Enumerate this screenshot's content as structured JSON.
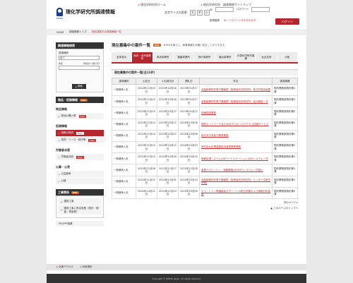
{
  "header": {
    "logo_sub": "RIKEN",
    "site_title": "理化学研究所調達情報",
    "links": [
      "理化学研究所ホーム",
      "文字サイズの変更",
      "理化学研究所　調達情報サイトマップ"
    ],
    "fontsize_label": "文字サイズの変更",
    "fontsize_buttons": [
      "大",
      "中",
      "小"
    ],
    "id_label": "ID",
    "pw_label": "パスワード",
    "register": "新規登録",
    "forgot": "ID・パスワードをお忘れの方",
    "login": "ログイン"
  },
  "breadcrumb": [
    "HOME",
    "調達情報トップ",
    "現在募集中の調達情報一覧"
  ],
  "sidebar": {
    "search_title": "調達情報検索",
    "category_label": "調達種別",
    "category_value": "全て",
    "keyword_label": "件名",
    "keyword_hint": "（件名の一部で可）",
    "search_button": "検索",
    "goods_title": "物品・役務情報",
    "goods_group": "物品情報",
    "goods_items": [
      "物品の購入等"
    ],
    "works_group": "役務情報",
    "works_items": [
      "役務の提供",
      "賃貸・リース・保守等"
    ],
    "labor_group": "労働者派遣",
    "labor_items": [
      "労働者派遣"
    ],
    "bid_group": "公募・公表",
    "bid_items": [
      "公益競争",
      "公募"
    ],
    "const_title": "工事関係",
    "const_items": [
      "建設工事",
      "建設工事に係る役務（設計・調査・測量等）"
    ],
    "pdf": "PFI/PPP事業",
    "new": "New"
  },
  "main": {
    "title": "現在募集中の案件一覧",
    "rss": "RSS",
    "note": "※RSSを使うと、新着情報を手軽に知ることができます。",
    "tabs": [
      "全体表示",
      "和光・本所事業所",
      "筑波事業所",
      "播磨事業所",
      "神戸事業所",
      "横浜事業所",
      "計算科学研究機構",
      "仙台支所",
      "大阪"
    ],
    "list_title": "現在募集中の案件一覧(全11件)",
    "columns": [
      "調達種別",
      "公告日",
      "入札締切日",
      "開札日",
      "件名",
      "調達機関"
    ],
    "rows": [
      [
        "一般競争入札",
        "2022年11月15日",
        "2022年12月16日",
        "2023年01月17日",
        "液晶軟骨物質電子顕微鏡（脳神経科学研究所）等共同運用装置",
        "契約業務部契約第1課"
      ],
      [
        "一般競争入札",
        "2022年11月15日",
        "2022年12月16日",
        "2023年01月17日",
        "液晶軟骨物質電子顕微鏡（脳神経科学研究所）高分解能一式",
        "契約業務部契約第1課"
      ],
      [
        "一般競争入札",
        "2022年11月15日",
        "2022年12月27日",
        "2023年01月27日",
        "設備調達業務",
        "契約業務部契約第2課"
      ],
      [
        "一般競争入札",
        "2022年11月14日",
        "2022年12月12日",
        "2022年12月26日",
        "理研ネットワーク及びSINET3 DCへのアクセス回線サービス",
        "契約業務部契約第1課"
      ],
      [
        "一般競争入札",
        "2022年11月14日",
        "2022年12月12日",
        "2022年12月26日",
        "和光市庁舎保守業務業務",
        "契約業務部契約第2課"
      ],
      [
        "一般競争入札",
        "2022年11月10日",
        "2022年12月12日",
        "2022年12月23日",
        "研究用水処理装置維持管理業務業務",
        "契約業務部契約第2課"
      ],
      [
        "一般競争入札",
        "2022年11月10日",
        "2022年12月09日",
        "2022年12月20日",
        "情報処理システム(ADワークステーション)ほかシステム一式",
        "契約業務部契約第1課"
      ],
      [
        "一般競争入札",
        "2022年11月08日",
        "2022年11月17日",
        "2022年11月28日",
        "産業オラビリティ・実験業務(KNERP)システム一式借入",
        "契約業務部契約第1課"
      ],
      [
        "一般競争入札",
        "2022年11月01日",
        "2022年12月01日",
        "2022年12月15日",
        "液晶軟骨物質電子顕微鏡（脳神経科学研究所）センター内研究所等)",
        "契約業務部契約第1課"
      ],
      [
        "一般競争入札",
        "2022年10月21日",
        "2022年11月24日",
        "2022年12月09日",
        "ナラ・トミノ等播磨高分子シートの耐久試験および情報分析装置",
        "契約業務部契約第2課"
      ]
    ],
    "next": "次のページ ▸",
    "top": "▲ このページのトップへ"
  },
  "footer": {
    "links": [
      "交通アクセス",
      "利用規約"
    ],
    "copyright": "Copyright © RIKEN, Japan. All rights reserved."
  }
}
